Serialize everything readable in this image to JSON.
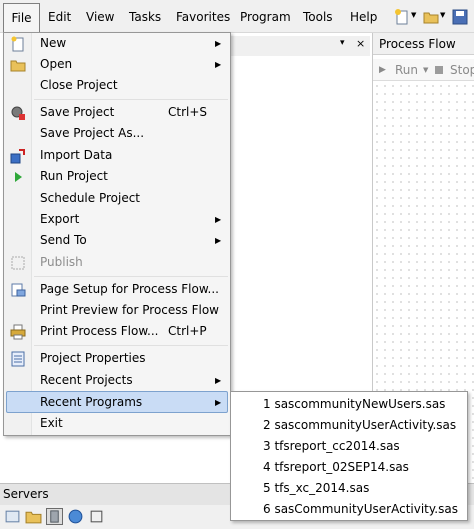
{
  "menubar": {
    "items": [
      "File",
      "Edit",
      "View",
      "Tasks",
      "Favorites",
      "Program",
      "Tools",
      "Help"
    ]
  },
  "left_pane": {
    "pin_glyph": "▾",
    "close_glyph": "×"
  },
  "process_flow": {
    "title": "Process Flow",
    "run_label": "Run",
    "stop_label": "Stop"
  },
  "status": {
    "servers_label": "Servers"
  },
  "file_menu": {
    "new": "New",
    "open": "Open",
    "close_project": "Close Project",
    "save_project": "Save Project",
    "save_project_shortcut": "Ctrl+S",
    "save_project_as": "Save Project As...",
    "import_data": "Import Data",
    "run_project": "Run Project",
    "schedule_project": "Schedule Project",
    "export": "Export",
    "send_to": "Send To",
    "publish": "Publish",
    "page_setup": "Page Setup for Process Flow...",
    "print_preview": "Print Preview for Process Flow",
    "print_process_flow": "Print Process Flow...",
    "print_shortcut": "Ctrl+P",
    "project_properties": "Project Properties",
    "recent_projects": "Recent Projects",
    "recent_programs": "Recent Programs",
    "exit": "Exit"
  },
  "recent_programs": [
    "1 sascommunityNewUsers.sas",
    "2 sascommunityUserActivity.sas",
    "3 tfsreport_cc2014.sas",
    "4 tfsreport_02SEP14.sas",
    "5 tfs_xc_2014.sas",
    "6 sasCommunityUserActivity.sas"
  ],
  "colors": {
    "highlight_bg": "#c9dcf5",
    "highlight_border": "#7da2ce",
    "menu_bg": "#f5f5f5"
  }
}
